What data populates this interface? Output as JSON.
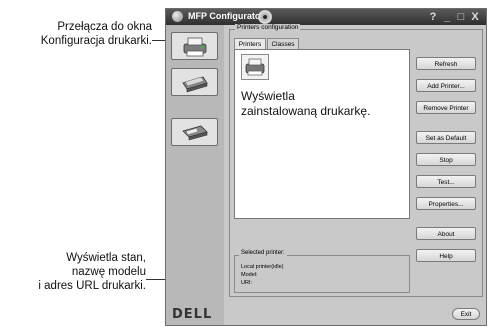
{
  "callouts": {
    "top_line1": "Przełącza do okna",
    "top_line2": "Konfiguracja drukarki.",
    "middle_line1": "Wyświetla",
    "middle_line2": "zainstalowaną drukarkę.",
    "bottom_line1": "Wyświetla stan,",
    "bottom_line2": "nazwę modelu",
    "bottom_line3": "i adres URL drukarki."
  },
  "window": {
    "title": "MFP Configurator",
    "controls": [
      "?",
      "_",
      "□",
      "X"
    ]
  },
  "left_panel": {
    "icons": [
      "printer-icon",
      "scanner-icon",
      "port-icon"
    ],
    "brand": "DELL"
  },
  "printers_configuration": {
    "label": "Printers configuration",
    "tabs": [
      "Printers",
      "Classes"
    ],
    "active_tab": "Printers"
  },
  "printer_list": {
    "items": [
      {
        "icon": "printer-icon"
      }
    ]
  },
  "buttons": {
    "refresh": "Refresh",
    "add_printer": "Add Printer...",
    "remove_printer": "Remove Printer",
    "set_default": "Set as Default",
    "stop": "Stop",
    "test": "Test...",
    "properties": "Properties...",
    "about": "About",
    "help": "Help",
    "exit": "Exit"
  },
  "selected_printer": {
    "label": "Selected printer:",
    "line1": "Local printer(idle)",
    "line2": "Model:",
    "line3": "URI:"
  },
  "colors": {
    "window_bg": "#c9c9c9",
    "titlebar": "#3c3c3c",
    "panel": "#b8b8b8"
  }
}
